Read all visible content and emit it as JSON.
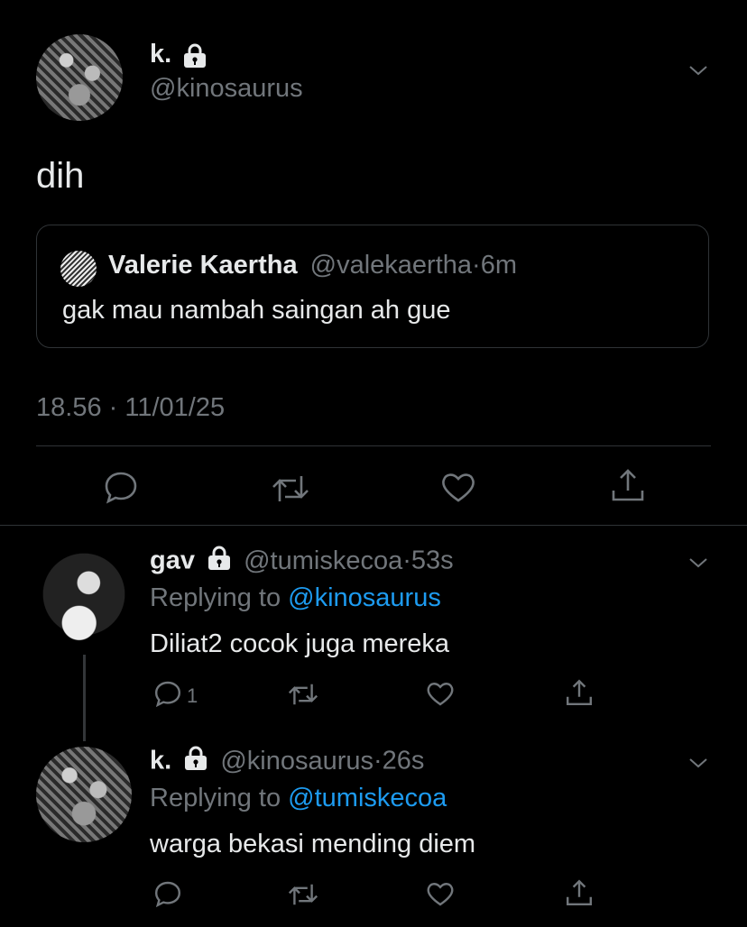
{
  "tweet": {
    "author_name": "k.",
    "author_handle": "@kinosaurus",
    "text": "dih",
    "quote": {
      "author_name": "Valerie Kaertha",
      "author_handle": "@valekaertha",
      "dot": "·",
      "time": "6m",
      "text": "gak mau nambah saingan ah gue"
    },
    "timestamp": "18.56 · 11/01/25"
  },
  "replies": [
    {
      "author_name": "gav",
      "author_handle": "@tumiskecoa",
      "dot": "·",
      "time": "53s",
      "replying_prefix": "Replying to ",
      "replying_to": "@kinosaurus",
      "text": "Diliat2 cocok juga mereka",
      "reply_count": "1"
    },
    {
      "author_name": "k.",
      "author_handle": "@kinosaurus",
      "dot": "·",
      "time": "26s",
      "replying_prefix": "Replying to ",
      "replying_to": "@tumiskecoa",
      "text": "warga bekasi mending diem",
      "reply_count": ""
    }
  ],
  "colors": {
    "background": "#000000",
    "text": "#e7e9ea",
    "muted": "#71767b",
    "link": "#1d9bf0",
    "border": "#2f3336"
  },
  "icons": [
    "lock-icon",
    "chevron-down-icon",
    "reply-icon",
    "retweet-icon",
    "like-icon",
    "share-icon"
  ]
}
